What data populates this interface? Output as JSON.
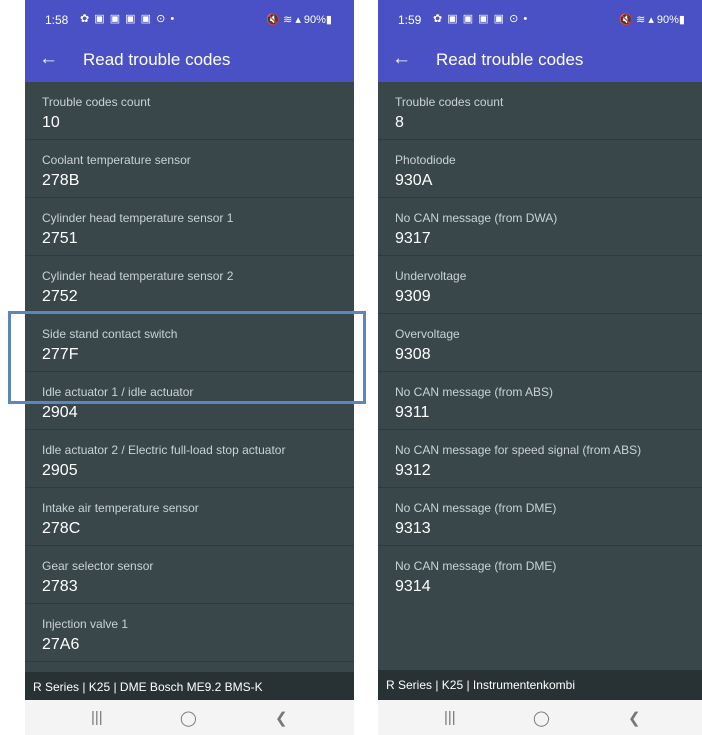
{
  "left_screen": {
    "status": {
      "time": "1:58",
      "notif_icons": "✿ ▣ ▣ ▣ ▣ ⊙ •",
      "system": "🔇 ≋ ▴ 90%▮"
    },
    "title": "Read trouble codes",
    "items": [
      {
        "label": "Trouble codes count",
        "value": "10"
      },
      {
        "label": "Coolant temperature sensor",
        "value": "278B"
      },
      {
        "label": "Cylinder head temperature sensor 1",
        "value": "2751"
      },
      {
        "label": "Cylinder head temperature sensor 2",
        "value": "2752"
      },
      {
        "label": "Side stand contact switch",
        "value": "277F"
      },
      {
        "label": "Idle actuator 1 / idle actuator",
        "value": "2904"
      },
      {
        "label": "Idle actuator 2 / Electric full-load stop actuator",
        "value": "2905"
      },
      {
        "label": "Intake air temperature sensor",
        "value": "278C"
      },
      {
        "label": "Gear selector sensor",
        "value": "2783"
      },
      {
        "label": "Injection valve 1",
        "value": "27A6"
      }
    ],
    "footer": "R Series | K25 | DME Bosch ME9.2 BMS-K",
    "nav": {
      "recents": "|||",
      "home": "◯",
      "back": "❮"
    }
  },
  "right_screen": {
    "status": {
      "time": "1:59",
      "notif_icons": "✿ ▣ ▣ ▣ ▣ ⊙ •",
      "system": "🔇 ≋ ▴ 90%▮"
    },
    "title": "Read trouble codes",
    "items": [
      {
        "label": "Trouble codes count",
        "value": "8"
      },
      {
        "label": "Photodiode",
        "value": "930A"
      },
      {
        "label": "No CAN message (from DWA)",
        "value": "9317"
      },
      {
        "label": "Undervoltage",
        "value": "9309"
      },
      {
        "label": "Overvoltage",
        "value": "9308"
      },
      {
        "label": "No CAN message (from ABS)",
        "value": "9311"
      },
      {
        "label": "No CAN message for speed signal (from ABS)",
        "value": "9312"
      },
      {
        "label": "No CAN message (from DME)",
        "value": "9313"
      },
      {
        "label": "No CAN message (from DME)",
        "value": "9314"
      }
    ],
    "footer": "R Series | K25 | Instrumentenkombi",
    "nav": {
      "recents": "|||",
      "home": "◯",
      "back": "❮"
    }
  },
  "colors": {
    "appbar": "#4a51c4",
    "list_bg": "#3a474a",
    "highlight": "#5d86bf",
    "footer": "#283234"
  },
  "icons": {
    "back": "arrow-left-icon"
  }
}
